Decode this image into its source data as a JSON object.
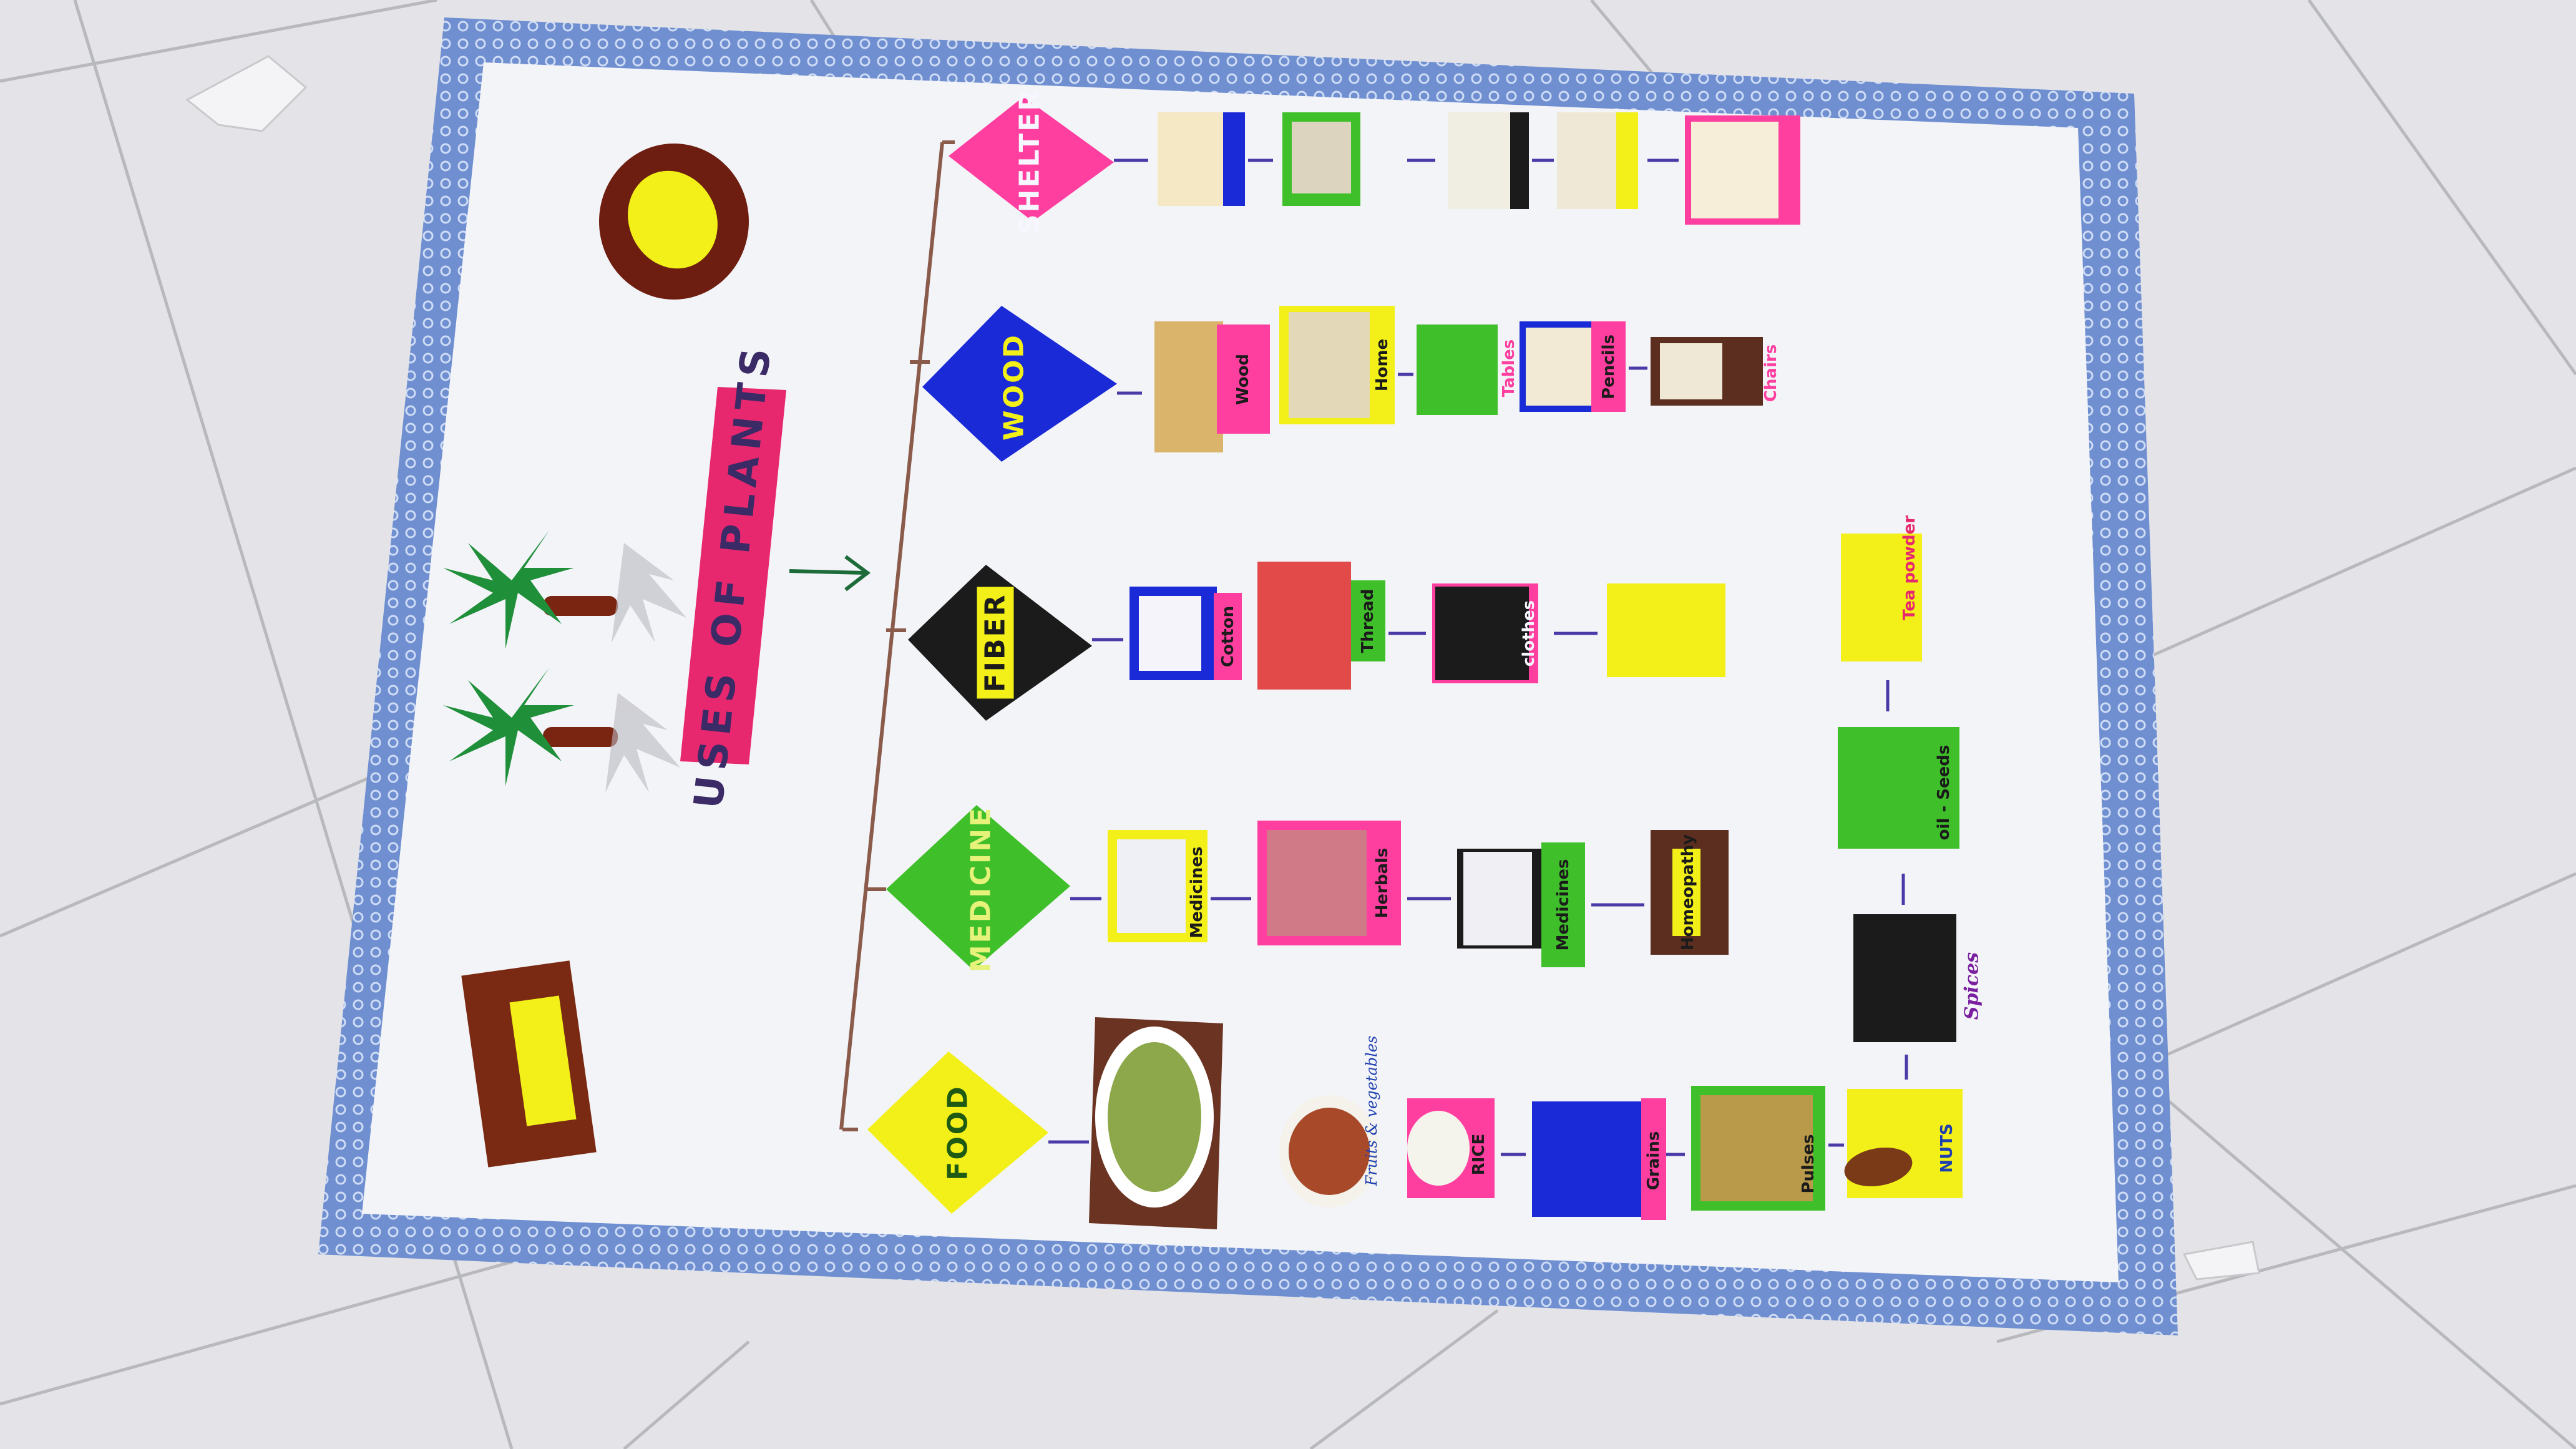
{
  "poster": {
    "title": "USES OF PLANTS",
    "colors": {
      "border_blue": "#6f8fd0",
      "paper": "#f3f4f8",
      "title_pink": "#e8286e",
      "pink": "#ff3fa0",
      "blue": "#1a2ad6",
      "black": "#1b1b1b",
      "green": "#3fbf2a",
      "yellow": "#f2f018",
      "connector": "#8a5a4a",
      "arrow_green": "#1e6b3a",
      "arrow_purple": "#4a3aa8"
    }
  },
  "categories": [
    {
      "name": "SHELTER",
      "shape_color": "pink",
      "text_color": "#f6f6ff",
      "items": [
        {
          "label": "",
          "icon": "bird-nest-icon"
        },
        {
          "label": "",
          "icon": "bird-nest-icon"
        },
        {
          "label": "",
          "icon": "tree-icon"
        },
        {
          "label": "",
          "icon": "squirrel-icon"
        },
        {
          "label": "",
          "icon": "owl-icon"
        }
      ]
    },
    {
      "name": "WOOD",
      "shape_color": "blue",
      "text_color": "#f2f018",
      "items": [
        {
          "label": "Wood",
          "icon": "log-icon"
        },
        {
          "label": "Home",
          "icon": "house-icon"
        },
        {
          "label": "Tables",
          "icon": "table-icon"
        },
        {
          "label": "Pencils",
          "icon": "pencil-icon"
        },
        {
          "label": "Chairs",
          "icon": "chair-icon"
        }
      ]
    },
    {
      "name": "FIBER",
      "shape_color": "black",
      "text_color": "#1b1b1b",
      "items": [
        {
          "label": "Cotton",
          "icon": "cotton-icon"
        },
        {
          "label": "Thread",
          "icon": "thread-spool-icon"
        },
        {
          "label": "clothes",
          "icon": "cloth-icon"
        },
        {
          "label": "",
          "icon": "sticks-icon"
        }
      ]
    },
    {
      "name": "MEDICINE",
      "shape_color": "green",
      "text_color": "#e6f27a",
      "items": [
        {
          "label": "Medicines",
          "icon": "medicine-bottles-icon"
        },
        {
          "label": "Herbals",
          "icon": "herb-icon"
        },
        {
          "label": "Medicines",
          "icon": "pill-bottle-icon"
        },
        {
          "label": "Homeopathy",
          "icon": "homeopathy-icon"
        }
      ]
    },
    {
      "name": "FOOD",
      "shape_color": "yellow",
      "text_color": "#1e5a14",
      "items": [
        {
          "label": "",
          "icon": "salad-bowl-icon"
        },
        {
          "label": "Fruits & vegetables",
          "icon": "fruit-basket-icon"
        },
        {
          "label": "RICE",
          "icon": "rice-bowl-icon"
        },
        {
          "label": "Grains",
          "icon": "grains-icon"
        },
        {
          "label": "Pulses",
          "icon": "pulses-icon"
        },
        {
          "label": "NUTS",
          "icon": "nut-icon"
        },
        {
          "label": "Spices",
          "icon": "spices-icon"
        },
        {
          "label": "oil - Seeds",
          "icon": "oil-seeds-icon"
        },
        {
          "label": "Tea powder",
          "icon": "tea-powder-icon"
        }
      ]
    }
  ]
}
